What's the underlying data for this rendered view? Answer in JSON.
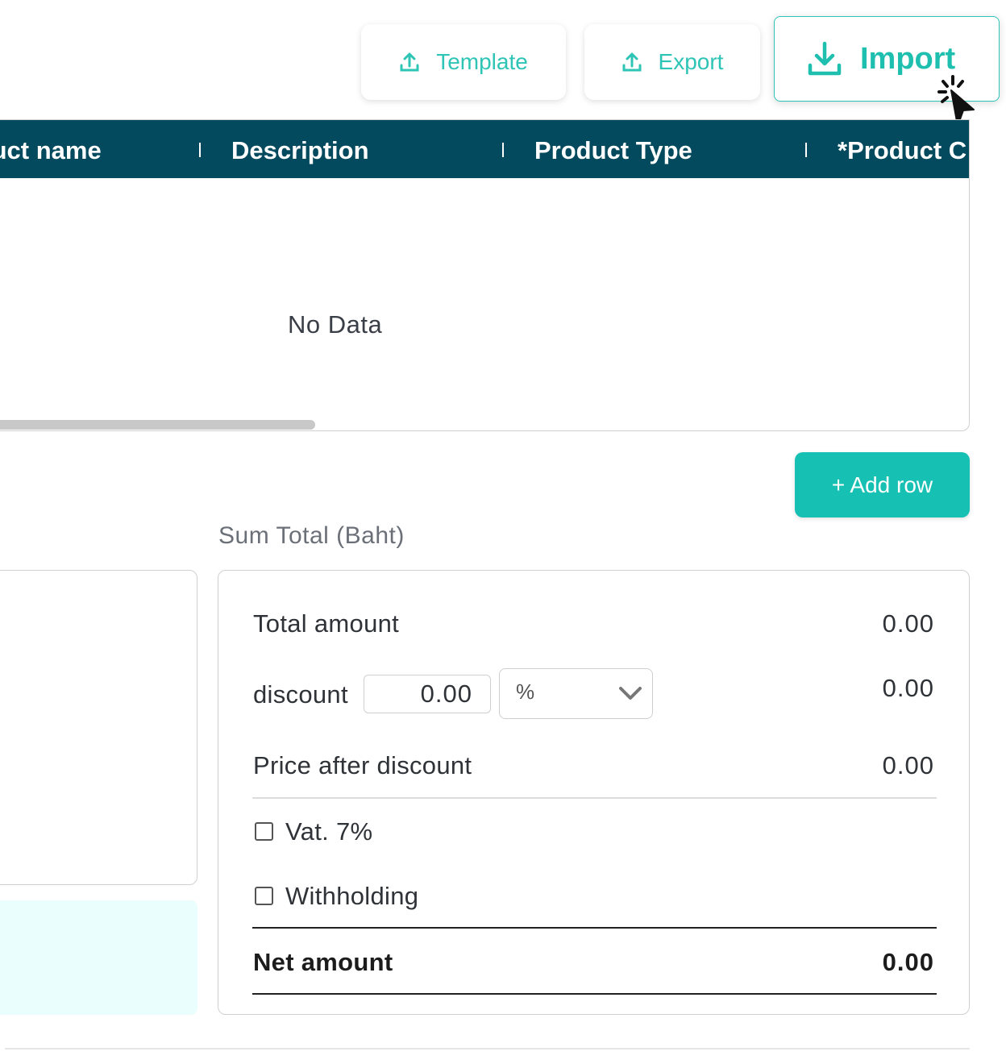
{
  "toolbar": {
    "template_label": "Template",
    "export_label": "Export",
    "import_label": "Import"
  },
  "table": {
    "columns": [
      "luct name",
      "Description",
      "Product Type",
      "*Product C"
    ],
    "empty_text": "No Data"
  },
  "add_row_label": "+ Add row",
  "summary": {
    "title": "Sum Total (Baht)",
    "total_amount_label": "Total amount",
    "total_amount_value": "0.00",
    "discount_label": "discount",
    "discount_input_value": "0.00",
    "discount_type_selected": "%",
    "discount_value": "0.00",
    "price_after_discount_label": "Price after discount",
    "price_after_discount_value": "0.00",
    "vat_label": "Vat. 7%",
    "vat_checked": false,
    "withholding_label": "Withholding",
    "withholding_checked": false,
    "net_amount_label": "Net amount",
    "net_amount_value": "0.00"
  },
  "colors": {
    "accent": "#16c1b4",
    "table_header_bg": "#044a5e",
    "note_bg": "#eafefd"
  }
}
